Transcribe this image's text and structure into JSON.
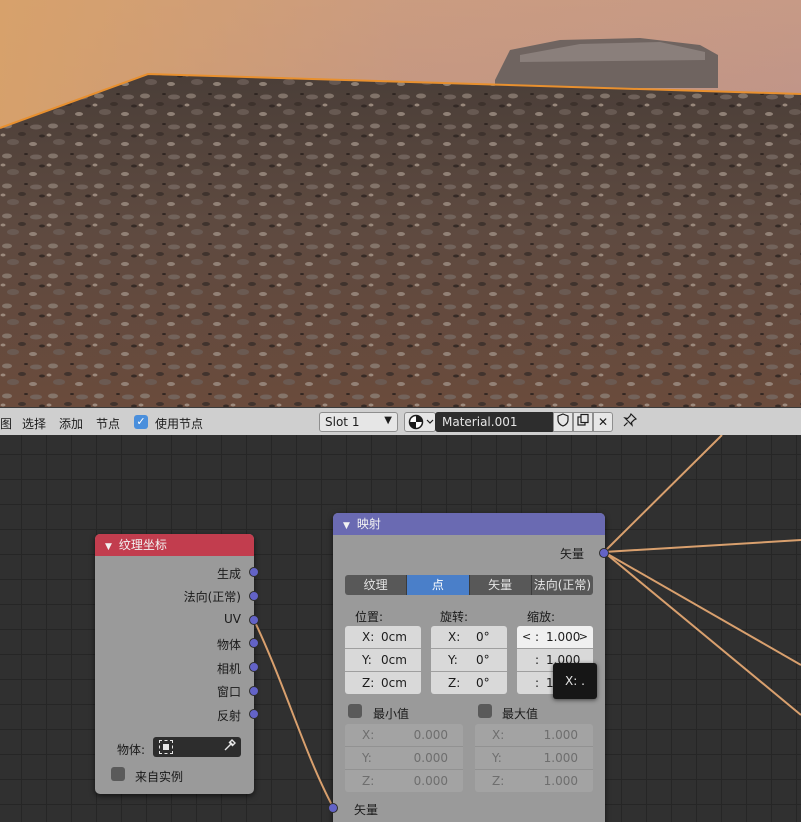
{
  "header": {
    "menu_view": "图",
    "menu_select": "选择",
    "menu_add": "添加",
    "menu_node": "节点",
    "use_nodes_label": "使用节点",
    "use_nodes_checked": true,
    "slot": "Slot 1",
    "material_name": "Material.001"
  },
  "tex_coord_node": {
    "title": "纹理坐标",
    "outputs": [
      "生成",
      "法向(正常)",
      "UV",
      "物体",
      "相机",
      "窗口",
      "反射"
    ],
    "object_label": "物体:",
    "from_instancer_label": "来自实例",
    "color": "#c23d4e"
  },
  "mapping_node": {
    "title": "映射",
    "output_label": "矢量",
    "types": [
      "纹理",
      "点",
      "矢量",
      "法向(正常)"
    ],
    "active_type": "点",
    "location_label": "位置:",
    "rotation_label": "旋转:",
    "scale_label": "缩放:",
    "location": [
      {
        "axis": "X:",
        "value": "0cm"
      },
      {
        "axis": "Y:",
        "value": "0cm"
      },
      {
        "axis": "Z:",
        "value": "0cm"
      }
    ],
    "rotation": [
      {
        "axis": "X:",
        "value": "0°"
      },
      {
        "axis": "Y:",
        "value": "0°"
      },
      {
        "axis": "Z:",
        "value": "0°"
      }
    ],
    "scale": [
      {
        "axis": ":",
        "value": "1.000"
      },
      {
        "axis": ":",
        "value": "1.000"
      },
      {
        "axis": ":",
        "value": "1."
      }
    ],
    "min_label": "最小值",
    "max_label": "最大值",
    "min": [
      {
        "axis": "X:",
        "value": "0.000"
      },
      {
        "axis": "Y:",
        "value": "0.000"
      },
      {
        "axis": "Z:",
        "value": "0.000"
      }
    ],
    "max": [
      {
        "axis": "X:",
        "value": "1.000"
      },
      {
        "axis": "Y:",
        "value": "1.000"
      },
      {
        "axis": "Z:",
        "value": "1.000"
      }
    ],
    "input_label": "矢量",
    "color": "#6a6ab2"
  },
  "tooltip": "X: .",
  "colors": {
    "link": "#d9a06e",
    "socket": "#6363c7",
    "active_option": "#4a7fc9",
    "selection_outline": "#e8902f"
  }
}
